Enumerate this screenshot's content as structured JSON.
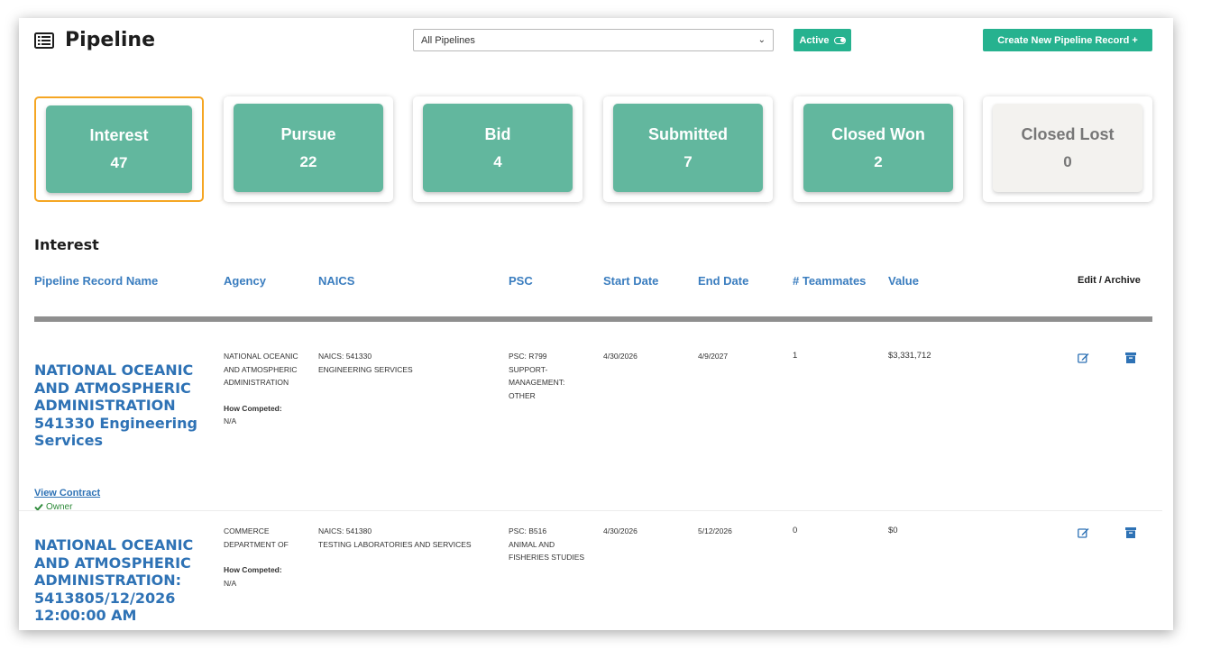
{
  "header": {
    "title": "Pipeline",
    "list_icon": "list-icon",
    "pipeline_select": {
      "value": "All Pipelines"
    },
    "active_toggle_label": "Active",
    "create_button_label": "Create New Pipeline Record +"
  },
  "stages": [
    {
      "name": "Interest",
      "count": "47",
      "selected": true
    },
    {
      "name": "Pursue",
      "count": "22",
      "selected": false
    },
    {
      "name": "Bid",
      "count": "4",
      "selected": false
    },
    {
      "name": "Submitted",
      "count": "7",
      "selected": false
    },
    {
      "name": "Closed Won",
      "count": "2",
      "selected": false
    },
    {
      "name": "Closed Lost",
      "count": "0",
      "selected": false
    }
  ],
  "section_title": "Interest",
  "columns": {
    "name": "Pipeline Record Name",
    "agency": "Agency",
    "naics": "NAICS",
    "psc": "PSC",
    "start": "Start Date",
    "end": "End Date",
    "teammates": "# Teammates",
    "value": "Value",
    "actions": "Edit / Archive"
  },
  "records": [
    {
      "name": "NATIONAL OCEANIC AND ATMOSPHERIC ADMINISTRATION 541330 Engineering Services",
      "agency_line1": "NATIONAL OCEANIC",
      "agency_line2": "AND ATMOSPHERIC",
      "agency_line3": "ADMINISTRATION",
      "how_competed_label": "How Competed:",
      "how_competed_value": "N/A",
      "naics_code": "NAICS: 541330",
      "naics_desc": "ENGINEERING SERVICES",
      "psc_line1": "PSC: R799",
      "psc_line2": "SUPPORT-",
      "psc_line3": "MANAGEMENT:",
      "psc_line4": "OTHER",
      "start_date": "4/30/2026",
      "end_date": "4/9/2027",
      "teammates": "1",
      "value": "$3,331,712",
      "view_link": "View Contract",
      "owner_label": "Owner"
    },
    {
      "name": "NATIONAL OCEANIC AND ATMOSPHERIC ADMINISTRATION: 5413805/12/2026 12:00:00 AM",
      "agency_line1": "COMMERCE",
      "agency_line2": "DEPARTMENT OF",
      "how_competed_label": "How Competed:",
      "how_competed_value": "N/A",
      "naics_code": "NAICS: 541380",
      "naics_desc": "TESTING LABORATORIES AND SERVICES",
      "psc_line1": "PSC: B516",
      "psc_line2": "ANIMAL AND",
      "psc_line3": "FISHERIES STUDIES",
      "start_date": "4/30/2026",
      "end_date": "5/12/2026",
      "teammates": "0",
      "value": "$0"
    }
  ],
  "colors": {
    "accent": "#26b28f",
    "stage_fill": "#62b79e",
    "link_blue": "#2e72b5",
    "header_blue": "#3a7dbf",
    "selected_border": "#f5a623"
  }
}
